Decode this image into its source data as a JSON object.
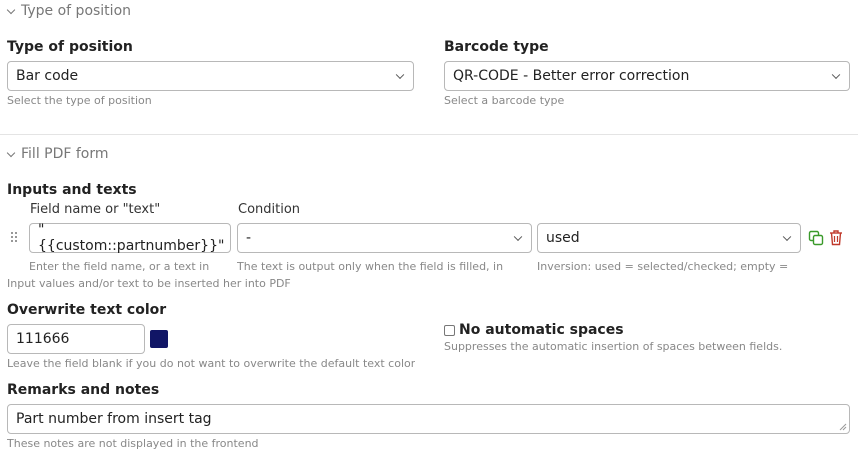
{
  "position_section": {
    "title": "Type of position",
    "type_label": "Type of position",
    "type_value": "Bar code",
    "type_help": "Select the type of position",
    "barcode_label": "Barcode type",
    "barcode_value": "QR-CODE - Better error correction",
    "barcode_help": "Select a barcode type"
  },
  "pdf_section": {
    "title": "Fill PDF form",
    "inputs_label": "Inputs and texts",
    "col_field": "Field name or \"text\"",
    "col_condition": "Condition",
    "row": {
      "field_value": "\"{{custom::partnumber}}\"",
      "condition_value": "-",
      "used_value": "used"
    },
    "help_field": "Enter the field name, or a text in",
    "help_condition": "The text is output only when the field is filled, in",
    "help_used": "Inversion: used = selected/checked; empty =",
    "help_general": "Input values and/or text to be inserted her into PDF",
    "color_label": "Overwrite text color",
    "color_value": "111666",
    "color_swatch": "#111666",
    "color_help": "Leave the field blank if you do not want to overwrite the default text color",
    "no_spaces_label": "No automatic spaces",
    "no_spaces_help": "Suppresses the automatic insertion of spaces between fields.",
    "remarks_label": "Remarks and notes",
    "remarks_value": "Part number from insert tag",
    "remarks_help": "These notes are not displayed in the frontend"
  },
  "colors": {
    "copy_icon": "#3a9a2a",
    "delete_icon": "#c0392b"
  }
}
